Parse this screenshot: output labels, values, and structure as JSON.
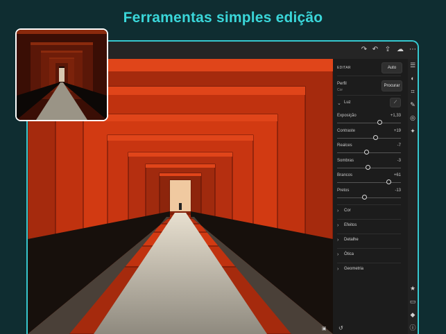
{
  "headline": "Ferramentas simples edição",
  "toolbar": {
    "icons": [
      "redo-icon",
      "undo-icon",
      "share-icon",
      "cloud-sync-icon",
      "more-icon"
    ]
  },
  "panel": {
    "section_title": "EDITAR",
    "auto_label": "Auto",
    "profile_label": "Perfil",
    "profile_value": "Cor",
    "browse_label": "Procurar",
    "light_label": "Luz",
    "sliders": [
      {
        "name": "Exposição",
        "value": "+1,33",
        "level": 0.67
      },
      {
        "name": "Contraste",
        "value": "+19",
        "level": 0.6
      },
      {
        "name": "Realces",
        "value": "-7",
        "level": 0.46
      },
      {
        "name": "Sombras",
        "value": "-3",
        "level": 0.48
      },
      {
        "name": "Brancos",
        "value": "+61",
        "level": 0.81
      },
      {
        "name": "Pretos",
        "value": "-13",
        "level": 0.43
      }
    ],
    "sections": [
      "Cor",
      "Efeitos",
      "Detalhe",
      "Ótica",
      "Geometria"
    ]
  },
  "rail": {
    "top_icons": [
      "sliders-icon",
      "presets-icon",
      "crop-icon",
      "brush-icon",
      "selective-icon",
      "healing-icon"
    ],
    "bottom_icons": [
      "star-icon",
      "comment-icon",
      "tag-icon",
      "info-icon"
    ]
  },
  "colors": {
    "accent": "#3ad6d9",
    "background": "#0f2d31",
    "torii_red": "#c8320f"
  }
}
